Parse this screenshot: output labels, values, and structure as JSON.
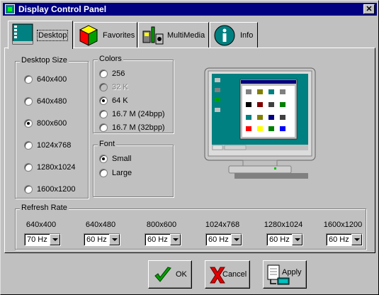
{
  "window": {
    "title": "Display Control Panel",
    "close_glyph": "✕"
  },
  "tabs": [
    {
      "label": "Desktop",
      "icon": "desktop-icon",
      "active": true
    },
    {
      "label": "Favorites",
      "icon": "favorites-cube-icon",
      "active": false
    },
    {
      "label": "MultiMedia",
      "icon": "multimedia-icon",
      "active": false
    },
    {
      "label": "Info",
      "icon": "info-icon",
      "active": false
    }
  ],
  "desktop_size": {
    "legend": "Desktop Size",
    "options": [
      "640x400",
      "640x480",
      "800x600",
      "1024x768",
      "1280x1024",
      "1600x1200"
    ],
    "selected": "800x600"
  },
  "colors": {
    "legend": "Colors",
    "options": [
      "256",
      "32 K",
      "64 K",
      "16.7 M (24bpp)",
      "16.7 M (32bpp)"
    ],
    "selected": "64 K",
    "disabled": [
      "32 K"
    ]
  },
  "font": {
    "legend": "Font",
    "options": [
      "Small",
      "Large"
    ],
    "selected": "Small"
  },
  "refresh_rate": {
    "legend": "Refresh Rate",
    "columns": [
      {
        "resolution": "640x400",
        "value": "70 Hz"
      },
      {
        "resolution": "640x480",
        "value": "60 Hz"
      },
      {
        "resolution": "800x600",
        "value": "60 Hz"
      },
      {
        "resolution": "1024x768",
        "value": "60 Hz"
      },
      {
        "resolution": "1280x1024",
        "value": "60 Hz"
      },
      {
        "resolution": "1600x1200",
        "value": "60 Hz"
      }
    ]
  },
  "buttons": {
    "ok_label": "OK",
    "cancel_label": "Cancel",
    "apply_label": "Apply"
  },
  "colors_theme": {
    "titlebar": "#000080",
    "face": "#c0c0c0",
    "desktop_teal": "#008080"
  }
}
